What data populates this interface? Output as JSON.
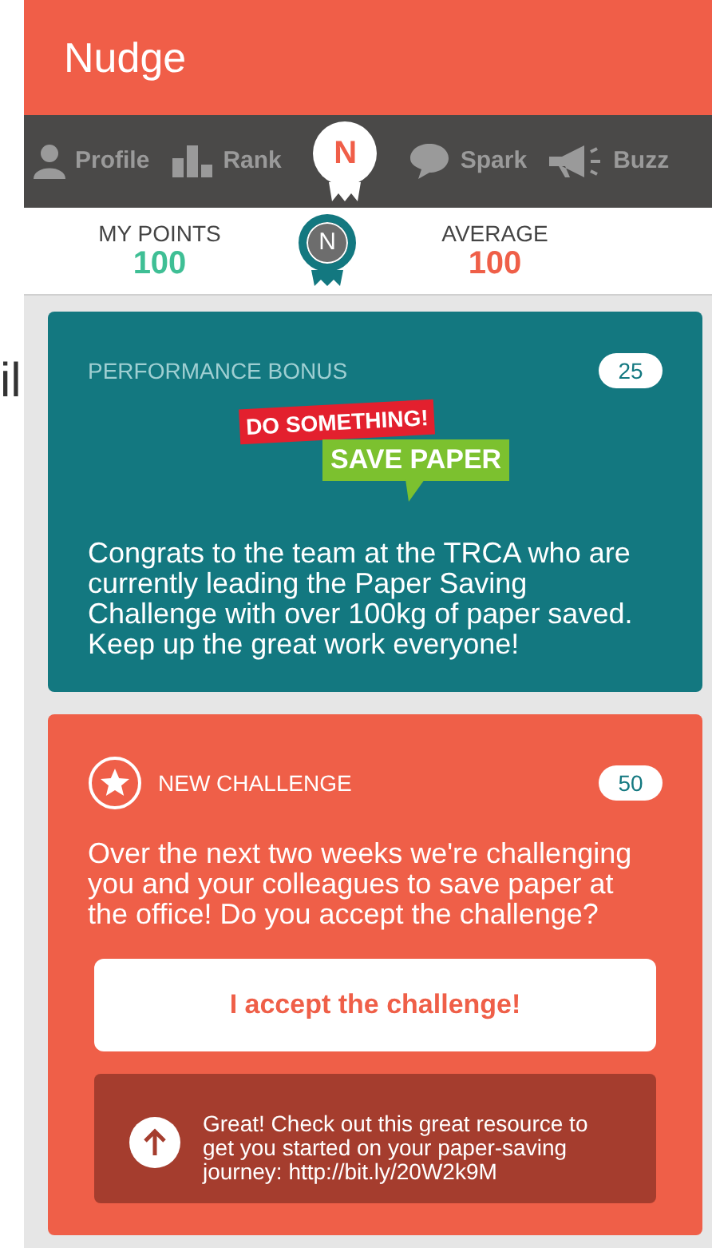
{
  "edge_fragment": "il",
  "app": {
    "title": "Nudge"
  },
  "tabs": [
    {
      "kind": "person",
      "label": "Profile",
      "selected": false
    },
    {
      "kind": "bars",
      "label": "Rank",
      "selected": false
    },
    {
      "kind": "badge",
      "label": "N",
      "selected": true
    },
    {
      "kind": "bubble",
      "label": "Spark",
      "selected": false
    },
    {
      "kind": "megaphone",
      "label": "Buzz",
      "selected": false
    }
  ],
  "stats": {
    "my_points": {
      "label": "MY POINTS",
      "value": "100"
    },
    "medal": "N",
    "average": {
      "label": "AVERAGE",
      "value": "100"
    }
  },
  "cards": [
    {
      "kind": "bonus",
      "title": "PERFORMANCE BONUS",
      "points": "25",
      "logo": {
        "top": "DO SOMETHING!",
        "bottom": "SAVE PAPER"
      },
      "text": "Congrats to the team at the TRCA who are currently leading the Paper Saving Challenge with over 100kg of paper saved. Keep up the great work everyone!"
    },
    {
      "kind": "challenge",
      "title": "NEW CHALLENGE",
      "points": "50",
      "text": "Over the next two weeks we're challenging you and your colleagues to save paper at the office! Do you accept the challenge?",
      "button": "I accept the challenge!",
      "reply": "Great! Check out this great resource to get you started on your paper-saving journey: http://bit.ly/20W2k9M"
    }
  ]
}
